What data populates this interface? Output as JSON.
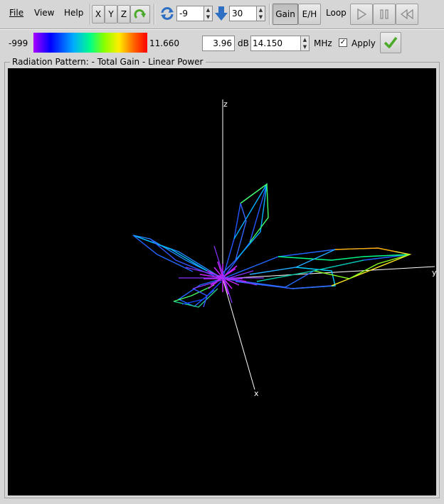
{
  "toolbar": {
    "menus": {
      "file": "File",
      "view": "View",
      "help": "Help"
    },
    "axis_buttons": {
      "x": "X",
      "y": "Y",
      "z": "Z"
    },
    "rotate_value": "-9",
    "tilt_value": "30",
    "gain_label": "Gain",
    "eh_label": "E/H",
    "loop_label": "Loop",
    "icons": {
      "refresh": "refresh-icon",
      "rotate": "rotate-icon",
      "down": "down-arrow-icon",
      "play": "play-icon",
      "pause": "pause-icon",
      "rewind": "rewind-icon"
    }
  },
  "scale_bar": {
    "min_label": "-999",
    "max_label": "11.660",
    "gain_value": "3.96",
    "gain_unit": "dB",
    "frequency_value": "14.150",
    "frequency_unit": "MHz",
    "apply_label": "Apply",
    "apply_checked": true,
    "icons": {
      "apply": "checkmark-icon"
    }
  },
  "view": {
    "frame_title": "Radiation Pattern: - Total Gain - Linear Power",
    "axis_labels": {
      "x": "x",
      "y": "y",
      "z": "z"
    }
  },
  "colors": {
    "window_bg": "#d6d6d6",
    "canvas_bg": "#000000",
    "gradient": [
      "#aa00ff",
      "#0000ff",
      "#00aaff",
      "#00ff88",
      "#88ff00",
      "#ffee00",
      "#ff6600",
      "#ff0000"
    ]
  }
}
